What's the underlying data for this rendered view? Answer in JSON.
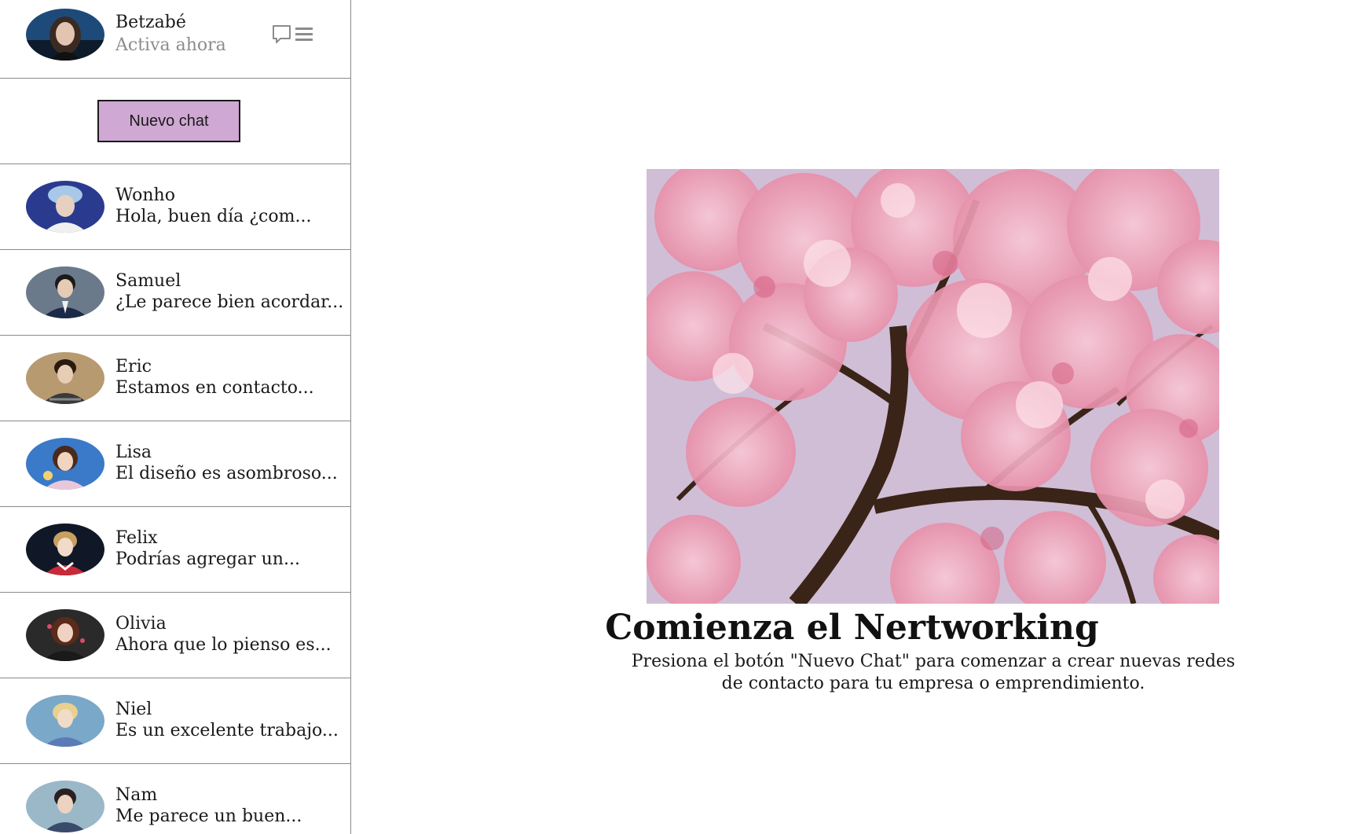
{
  "profile": {
    "name": "Betzabé",
    "status": "Activa ahora"
  },
  "new_chat_label": "Nuevo chat",
  "chats": [
    {
      "name": "Wonho",
      "preview": "Hola, buen día ¿com..."
    },
    {
      "name": "Samuel",
      "preview": "¿Le parece bien acordar..."
    },
    {
      "name": "Eric",
      "preview": "Estamos en contacto..."
    },
    {
      "name": "Lisa",
      "preview": "El diseño es asombroso..."
    },
    {
      "name": "Felix",
      "preview": "Podrías agregar un..."
    },
    {
      "name": "Olivia",
      "preview": "Ahora que lo pienso es..."
    },
    {
      "name": "Niel",
      "preview": "Es un excelente trabajo..."
    },
    {
      "name": "Nam",
      "preview": "Me parece un buen..."
    }
  ],
  "main": {
    "title": "Comienza el Nertworking",
    "description": "Presiona el botón \"Nuevo Chat\" para comenzar a crear nuevas redes de contacto para tu empresa o emprendimiento."
  },
  "icons": {
    "chat": "chat-bubble-icon",
    "menu": "menu-icon"
  },
  "colors": {
    "button_bg": "#cfa8d3",
    "divider": "#8a8a8a",
    "status_text": "#8c8c8c"
  }
}
